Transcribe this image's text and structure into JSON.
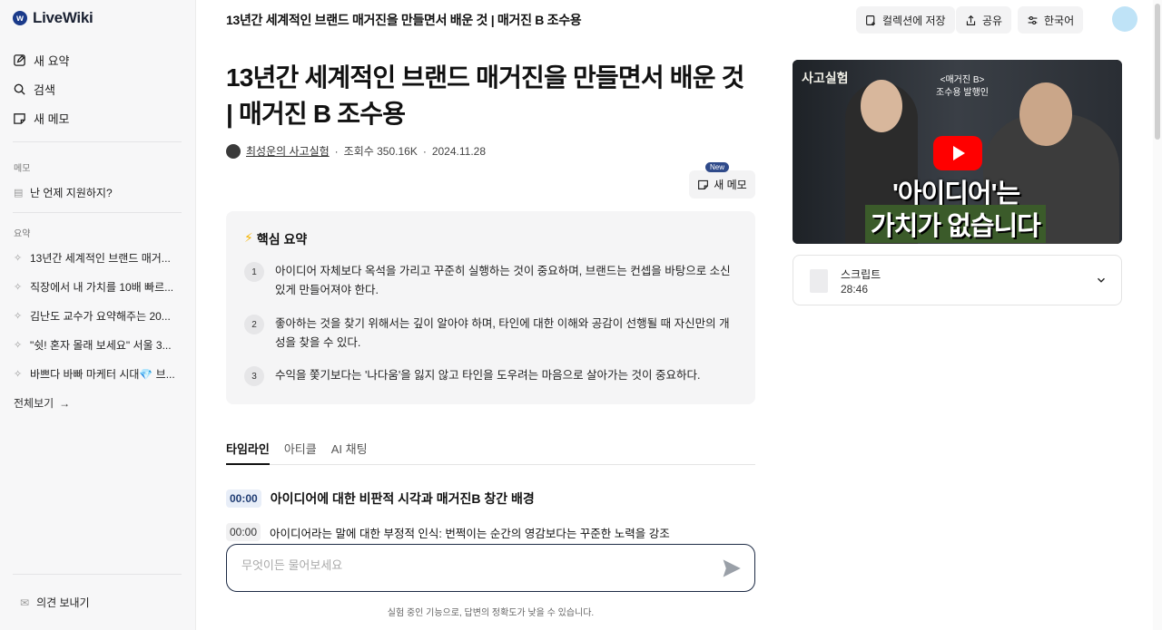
{
  "app": {
    "name": "LiveWiki"
  },
  "sidebar": {
    "nav": [
      {
        "label": "새 요약",
        "icon": "edit-icon"
      },
      {
        "label": "검색",
        "icon": "search-icon"
      },
      {
        "label": "새 메모",
        "icon": "memo-icon"
      }
    ],
    "memo_section_label": "메모",
    "memos": [
      {
        "label": "난 언제 지원하지?"
      }
    ],
    "summary_section_label": "요약",
    "summaries": [
      {
        "label": "13년간 세계적인 브랜드 매거..."
      },
      {
        "label": "직장에서 내 가치를 10배 빠르..."
      },
      {
        "label": "김난도 교수가 요약해주는 20..."
      },
      {
        "label": "\"쉿! 혼자 몰래 보세요\" 서울 3..."
      },
      {
        "label": "바쁘다 바빠 마케터 시대💎 브..."
      }
    ],
    "see_all": "전체보기",
    "feedback": "의견 보내기"
  },
  "header": {
    "title": "13년간 세계적인 브랜드 매거진을 만들면서 배운 것 | 매거진 B 조수용",
    "save_collection": "컬렉션에 저장",
    "share": "공유",
    "language": "한국어"
  },
  "main": {
    "title": "13년간 세계적인 브랜드 매거진을 만들면서 배운 것 | 매거진 B 조수용",
    "channel": "최성운의 사고실험",
    "views": "조회수 350.16K",
    "date": "2024.11.28",
    "memo_button": "새 메모",
    "new_badge": "New",
    "summary": {
      "title": "핵심 요약",
      "items": [
        {
          "num": "1",
          "text": "아이디어 자체보다 옥석을 가리고 꾸준히 실행하는 것이 중요하며, 브랜드는 컨셉을 바탕으로 소신 있게 만들어져야 한다."
        },
        {
          "num": "2",
          "text": "좋아하는 것을 찾기 위해서는 깊이 알아야 하며, 타인에 대한 이해와 공감이 선행될 때 자신만의 개성을 찾을 수 있다."
        },
        {
          "num": "3",
          "text": "수익을 쫓기보다는 '나다움'을 잃지 않고 타인을 도우려는 마음으로 살아가는 것이 중요하다."
        }
      ]
    },
    "tabs": [
      {
        "label": "타임라인",
        "active": true
      },
      {
        "label": "아티클",
        "active": false
      },
      {
        "label": "AI 채팅",
        "active": false
      }
    ],
    "timeline": {
      "head_time": "00:00",
      "head_title": "아이디어에 대한 비판적 시각과 매거진B 창간 배경",
      "row_time": "00:00",
      "row_text": "아이디어라는 말에 대한 부정적 인식: 번쩍이는 순간의 영감보다는 꾸준한 노력을 강조"
    },
    "ask": {
      "placeholder": "무엇이든 물어보세요",
      "value": ""
    },
    "disclaimer": "실험 중인 기능으로, 답변의 정확도가 낮을 수 있습니다."
  },
  "video": {
    "brand": "사고실험",
    "note_line1": "<매거진 B>",
    "note_line2": "조수용 발행인",
    "caption1": "'아이디어'는",
    "caption2": "가치가 없습니다"
  },
  "script": {
    "label": "스크립트",
    "duration": "28:46"
  },
  "colors": {
    "accent": "#1c2a44",
    "badge": "#2f4a8a",
    "youtube": "#ff0000",
    "timestamp_bg": "#e8eef8"
  }
}
